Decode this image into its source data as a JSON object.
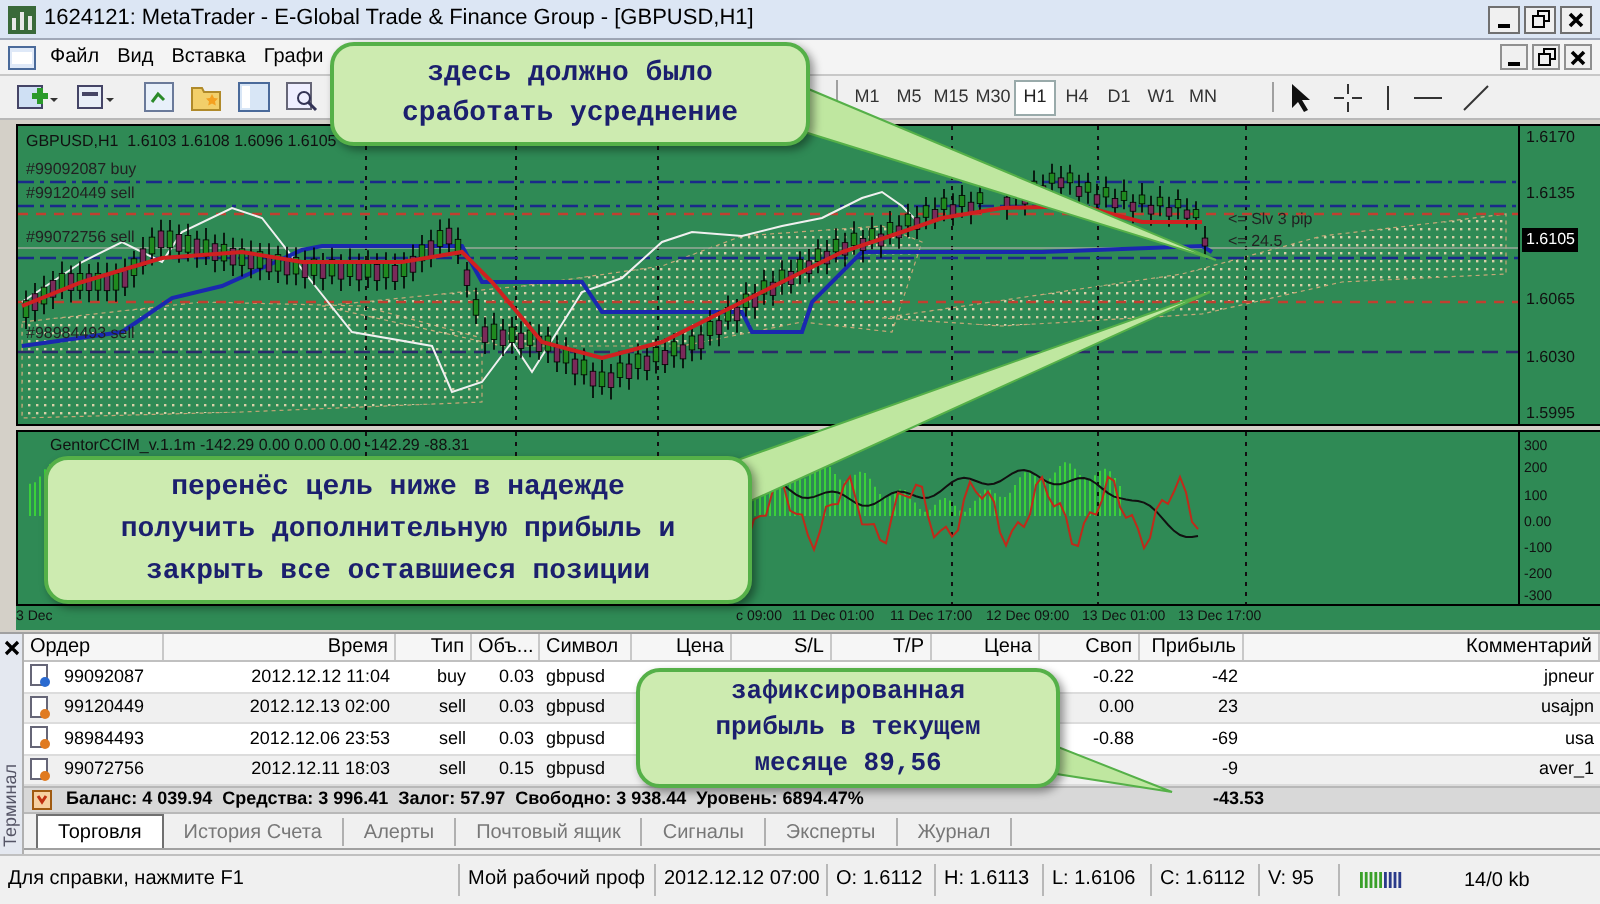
{
  "window": {
    "title": "1624121: MetaTrader - E-Global Trade & Finance Group - [GBPUSD,H1]"
  },
  "menu": [
    "Файл",
    "Вид",
    "Вставка",
    "Графи"
  ],
  "timeframes": [
    {
      "label": "M1",
      "selected": false
    },
    {
      "label": "M5",
      "selected": false
    },
    {
      "label": "M15",
      "selected": false
    },
    {
      "label": "M30",
      "selected": false
    },
    {
      "label": "H1",
      "selected": true
    },
    {
      "label": "H4",
      "selected": false
    },
    {
      "label": "D1",
      "selected": false
    },
    {
      "label": "W1",
      "selected": false
    },
    {
      "label": "MN",
      "selected": false
    }
  ],
  "chart": {
    "header": "GBPUSD,H1  1.6103 1.6108 1.6096 1.6105",
    "order_labels": [
      "#99092087 buy",
      "#99120449 sell",
      "#99072756 sell",
      "#98984493 sell"
    ],
    "price_labels": [
      {
        "label": "1.6170",
        "kind": "tick"
      },
      {
        "label": "1.6135",
        "kind": "tick"
      },
      {
        "label": "1.6105",
        "kind": "current"
      },
      {
        "label": "1.6065",
        "kind": "tick"
      },
      {
        "label": "1.6030",
        "kind": "tick"
      },
      {
        "label": "1.5995",
        "kind": "tick"
      }
    ],
    "markers": [
      "<= Slv 3 pip",
      "<= 24.5"
    ],
    "indicator": {
      "label": "GentorCCIM_v.1.1m -142.29 0.00 0.00 0.00 -142.29 -88.31",
      "scale": [
        "300",
        "200",
        "100",
        "0.00",
        "-100",
        "-200",
        "-300"
      ]
    },
    "time_labels": [
      "3 Dec",
      "c 09:00",
      "11 Dec 01:00",
      "11 Dec 17:00",
      "12 Dec 09:00",
      "13 Dec 01:00",
      "13 Dec 17:00"
    ]
  },
  "callouts": [
    {
      "lines": [
        "здесь должно было",
        "сработать усреднение"
      ]
    },
    {
      "lines": [
        "перенёс цель ниже в надежде",
        "получить дополнительную прибыль и",
        "закрыть все оставшиеся позиции"
      ]
    },
    {
      "lines": [
        "зафиксированная",
        "прибыль в текущем",
        "месяце 89,56"
      ]
    }
  ],
  "terminal": {
    "side_label": "Терминал",
    "columns": [
      "Ордер",
      "Время",
      "Тип",
      "Объ...",
      "Символ",
      "Цена",
      "S/L",
      "T/P",
      "Цена",
      "Своп",
      "Прибыль",
      "Комментарий"
    ],
    "rows": [
      {
        "kind": "buy",
        "order": "99092087",
        "time": "2012.12.12 11:04",
        "type": "buy",
        "volume": "0.03",
        "symbol": "gbpusd",
        "swap": "-0.22",
        "profit": "-42",
        "comment": "jpneur"
      },
      {
        "kind": "sell",
        "order": "99120449",
        "time": "2012.12.13 02:00",
        "type": "sell",
        "volume": "0.03",
        "symbol": "gbpusd",
        "swap": "0.00",
        "profit": "23",
        "comment": "usajpn"
      },
      {
        "kind": "sell",
        "order": "98984493",
        "time": "2012.12.06 23:53",
        "type": "sell",
        "volume": "0.03",
        "symbol": "gbpusd",
        "swap": "-0.88",
        "profit": "-69",
        "comment": "usa"
      },
      {
        "kind": "sell",
        "order": "99072756",
        "time": "2012.12.11 18:03",
        "type": "sell",
        "volume": "0.15",
        "symbol": "gbpusd",
        "swap": "",
        "profit": "-9",
        "comment": "aver_1"
      }
    ],
    "balance": "Баланс: 4 039.94  Средства: 3 996.41  Залог: 57.97  Свободно: 3 938.44  Уровень: 6894.47%",
    "total_profit": "-43.53",
    "tabs": [
      {
        "label": "Торговля",
        "selected": true
      },
      {
        "label": "История Счета",
        "selected": false
      },
      {
        "label": "Алерты",
        "selected": false
      },
      {
        "label": "Почтовый ящик",
        "selected": false
      },
      {
        "label": "Сигналы",
        "selected": false
      },
      {
        "label": "Эксперты",
        "selected": false
      },
      {
        "label": "Журнал",
        "selected": false
      }
    ]
  },
  "status_bar": {
    "help": "Для справки, нажмите F1",
    "profile": "Мой рабочий проф",
    "date": "2012.12.12 07:00",
    "open": "O: 1.6112",
    "high": "H: 1.6113",
    "low": "L: 1.6106",
    "close": "C: 1.6112",
    "volume": "V: 95",
    "traffic": "14/0 kb"
  }
}
